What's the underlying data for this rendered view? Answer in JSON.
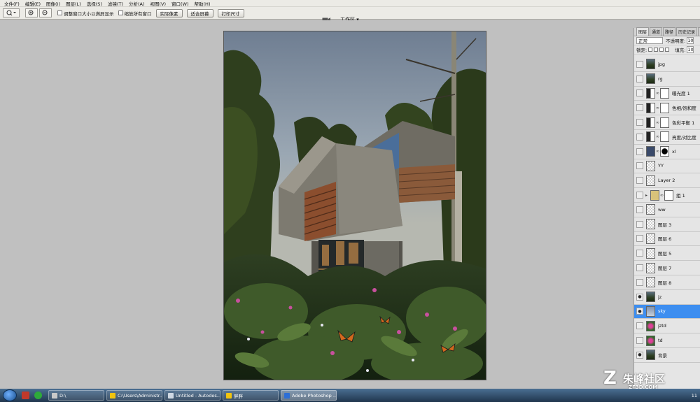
{
  "menu": [
    "文件(F)",
    "编辑(E)",
    "图像(I)",
    "图层(L)",
    "选择(S)",
    "滤镜(T)",
    "分析(A)",
    "视图(V)",
    "窗口(W)",
    "帮助(H)"
  ],
  "options": {
    "check_resize": "调整窗口大小以满屏显示",
    "check_zoom_all": "缩放所有窗口",
    "btn_actual": "实际像素",
    "btn_fit": "适合屏幕",
    "btn_print": "打印尺寸",
    "workspace": "工作区 ▾"
  },
  "panel": {
    "tabs": [
      "图层",
      "通道",
      "路径",
      "历史记录",
      "动作"
    ],
    "blend_mode": "正常",
    "opacity_label": "不透明度:",
    "opacity_value": "100",
    "lock_label": "锁定:",
    "fill_label": "填充:",
    "fill_value": "100"
  },
  "layers": [
    {
      "name": "jpg",
      "visible": false,
      "thumb": "photo",
      "mask": false
    },
    {
      "name": "rg",
      "visible": false,
      "thumb": "photo",
      "mask": false
    },
    {
      "name": "曝光度 1",
      "visible": false,
      "thumb": "adjust",
      "mask": true
    },
    {
      "name": "色相/饱和度",
      "visible": false,
      "thumb": "adjust",
      "mask": true
    },
    {
      "name": "色彩平衡 1",
      "visible": false,
      "thumb": "adjust",
      "mask": true
    },
    {
      "name": "亮度/对比度",
      "visible": false,
      "thumb": "adjust",
      "mask": true
    },
    {
      "name": "xl",
      "visible": false,
      "thumb": "navy",
      "mask": true
    },
    {
      "name": "YY",
      "visible": false,
      "thumb": "transparent",
      "mask": false
    },
    {
      "name": "Layer 2",
      "visible": false,
      "thumb": "transparent",
      "mask": false
    },
    {
      "name": "组 1",
      "visible": false,
      "thumb": "group",
      "mask": true
    },
    {
      "name": "ww",
      "visible": false,
      "thumb": "transparent",
      "mask": false
    },
    {
      "name": "图层 3",
      "visible": false,
      "thumb": "transparent",
      "mask": false
    },
    {
      "name": "图层 6",
      "visible": false,
      "thumb": "transparent",
      "mask": false
    },
    {
      "name": "图层 5",
      "visible": false,
      "thumb": "transparent",
      "mask": false
    },
    {
      "name": "图层 7",
      "visible": false,
      "thumb": "transparent",
      "mask": false
    },
    {
      "name": "图层 8",
      "visible": false,
      "thumb": "transparent",
      "mask": false
    },
    {
      "name": "jz",
      "visible": true,
      "thumb": "photo",
      "mask": false
    },
    {
      "name": "sky",
      "visible": true,
      "thumb": "sky",
      "mask": false,
      "selected": true
    },
    {
      "name": "jztd",
      "visible": false,
      "thumb": "flower",
      "mask": false
    },
    {
      "name": "td",
      "visible": false,
      "thumb": "flower",
      "mask": false
    },
    {
      "name": "背景",
      "visible": true,
      "thumb": "photo",
      "mask": false
    }
  ],
  "taskbar": {
    "items": [
      {
        "label": "D:\\",
        "active": false
      },
      {
        "label": "C:\\Users\\Administr...",
        "active": false
      },
      {
        "label": "Untitled - Autodes...",
        "active": false
      },
      {
        "label": "胖胖",
        "active": false
      },
      {
        "label": "Adobe Photoshop ...",
        "active": true
      }
    ],
    "clock": "11"
  },
  "watermark": {
    "text": "朱峰社区",
    "sub": "ZF3D.COM"
  },
  "colors": {
    "selection": "#3d8ef0",
    "taskbar": "#20354d",
    "canvas_bg": "#c0c0c0"
  }
}
